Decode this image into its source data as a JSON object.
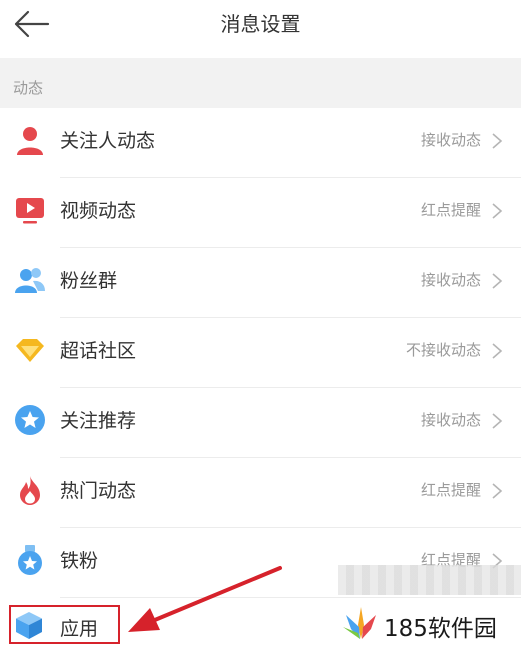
{
  "header": {
    "title": "消息设置"
  },
  "section": {
    "label": "动态"
  },
  "rows": [
    {
      "label": "关注人动态",
      "value": "接收动态",
      "icon": "person-icon",
      "color": "#e5484d"
    },
    {
      "label": "视频动态",
      "value": "红点提醒",
      "icon": "video-play-icon",
      "color": "#e5484d"
    },
    {
      "label": "粉丝群",
      "value": "接收动态",
      "icon": "fan-group-icon",
      "color": "#4aa3ef"
    },
    {
      "label": "超话社区",
      "value": "不接收动态",
      "icon": "diamond-icon",
      "color": "#f5b81f"
    },
    {
      "label": "关注推荐",
      "value": "接收动态",
      "icon": "star-badge-icon",
      "color": "#4aa3ef"
    },
    {
      "label": "热门动态",
      "value": "红点提醒",
      "icon": "flame-icon",
      "color": "#e5484d"
    },
    {
      "label": "铁粉",
      "value": "红点提醒",
      "icon": "medal-icon",
      "color": "#4aa3ef"
    }
  ],
  "app_row": {
    "label": "应用",
    "icon": "cube-icon"
  },
  "annotation": {
    "highlight_color": "#d6222b"
  },
  "watermark": {
    "text": "185软件园"
  }
}
